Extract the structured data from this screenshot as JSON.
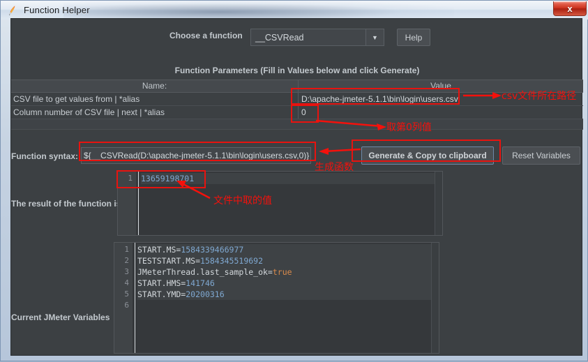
{
  "window": {
    "title": "Function Helper",
    "icon": "jmeter-feather-icon",
    "close_label": "x"
  },
  "toolbar": {
    "choose_label": "Choose a function",
    "selected_function": "__CSVRead",
    "dropdown_icon": "chevron-down-icon",
    "help_label": "Help"
  },
  "params": {
    "title": "Function Parameters (Fill in Values below and click Generate)",
    "columns": [
      "Name:",
      "Value"
    ],
    "rows": [
      {
        "name": "CSV file to get values from | *alias",
        "value": "D:\\apache-jmeter-5.1.1\\bin\\login\\users.csv"
      },
      {
        "name": "Column number of CSV file | next | *alias",
        "value": "0"
      }
    ]
  },
  "syntax": {
    "label": "Function syntax:",
    "value": "${__CSVRead(D:\\apache-jmeter-5.1.1\\bin\\login\\users.csv,0)}",
    "generate_label": "Generate & Copy to clipboard",
    "reset_label": "Reset Variables"
  },
  "result": {
    "label": "The result of the function is",
    "gutter": [
      "1"
    ],
    "lines": [
      {
        "segments": [
          {
            "text": "13659198701",
            "kind": "num"
          }
        ]
      }
    ]
  },
  "variables": {
    "label": "Current JMeter Variables",
    "gutter": [
      "1",
      "2",
      "3",
      "4",
      "5",
      "6"
    ],
    "lines": [
      {
        "segments": [
          {
            "text": "START.MS=",
            "kind": "plain"
          },
          {
            "text": "1584339466977",
            "kind": "num"
          }
        ]
      },
      {
        "segments": [
          {
            "text": "TESTSTART.MS=",
            "kind": "plain"
          },
          {
            "text": "1584345519692",
            "kind": "num"
          }
        ]
      },
      {
        "segments": [
          {
            "text": "JMeterThread.last_sample_ok=",
            "kind": "plain"
          },
          {
            "text": "true",
            "kind": "bool"
          }
        ]
      },
      {
        "segments": [
          {
            "text": "START.HMS=",
            "kind": "plain"
          },
          {
            "text": "141746",
            "kind": "num"
          }
        ]
      },
      {
        "segments": [
          {
            "text": "START.YMD=",
            "kind": "plain"
          },
          {
            "text": "20200316",
            "kind": "num"
          }
        ]
      },
      {
        "segments": [
          {
            "text": "",
            "kind": "plain"
          }
        ]
      }
    ]
  },
  "annotations": {
    "color": "#f4110c",
    "notes": [
      {
        "id": "csv-path-note",
        "text": "csv文件所在路径"
      },
      {
        "id": "column-note",
        "text": "取第0列值"
      },
      {
        "id": "generate-note",
        "text": "生成函数"
      },
      {
        "id": "result-note",
        "text": "文件中取的值"
      }
    ]
  }
}
